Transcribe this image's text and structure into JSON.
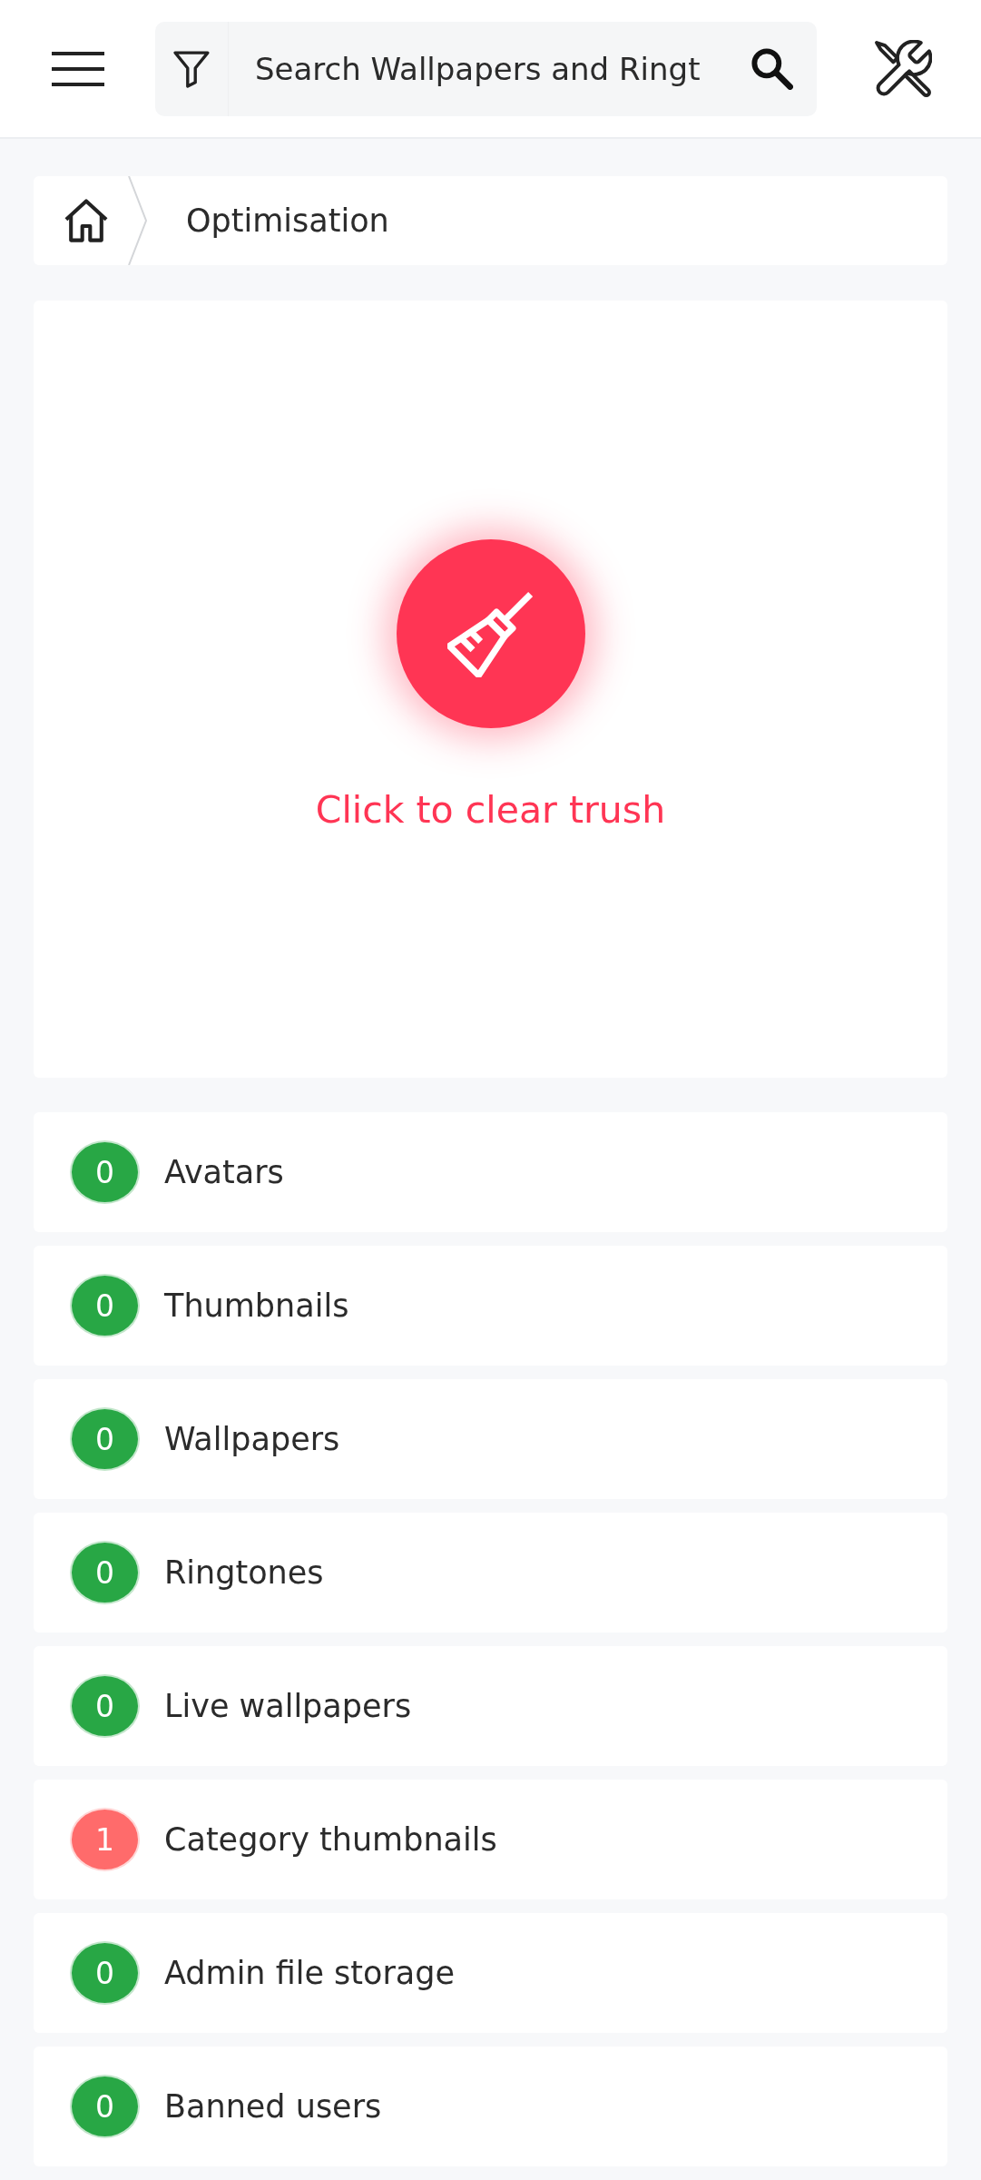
{
  "header": {
    "search": {
      "placeholder": "Search Wallpapers and Ringt"
    }
  },
  "breadcrumb": {
    "current": "Optimisation"
  },
  "cleaner": {
    "caption": "Click to clear trush"
  },
  "counters": [
    {
      "count": "0",
      "label": "Avatars",
      "color": "#28a745"
    },
    {
      "count": "0",
      "label": "Thumbnails",
      "color": "#28a745"
    },
    {
      "count": "0",
      "label": "Wallpapers",
      "color": "#28a745"
    },
    {
      "count": "0",
      "label": "Ringtones",
      "color": "#28a745"
    },
    {
      "count": "0",
      "label": "Live wallpapers",
      "color": "#28a745"
    },
    {
      "count": "1",
      "label": "Category thumbnails",
      "color": "#ff6b6b"
    },
    {
      "count": "0",
      "label": "Admin file storage",
      "color": "#28a745"
    },
    {
      "count": "0",
      "label": "Banned users",
      "color": "#28a745"
    }
  ]
}
